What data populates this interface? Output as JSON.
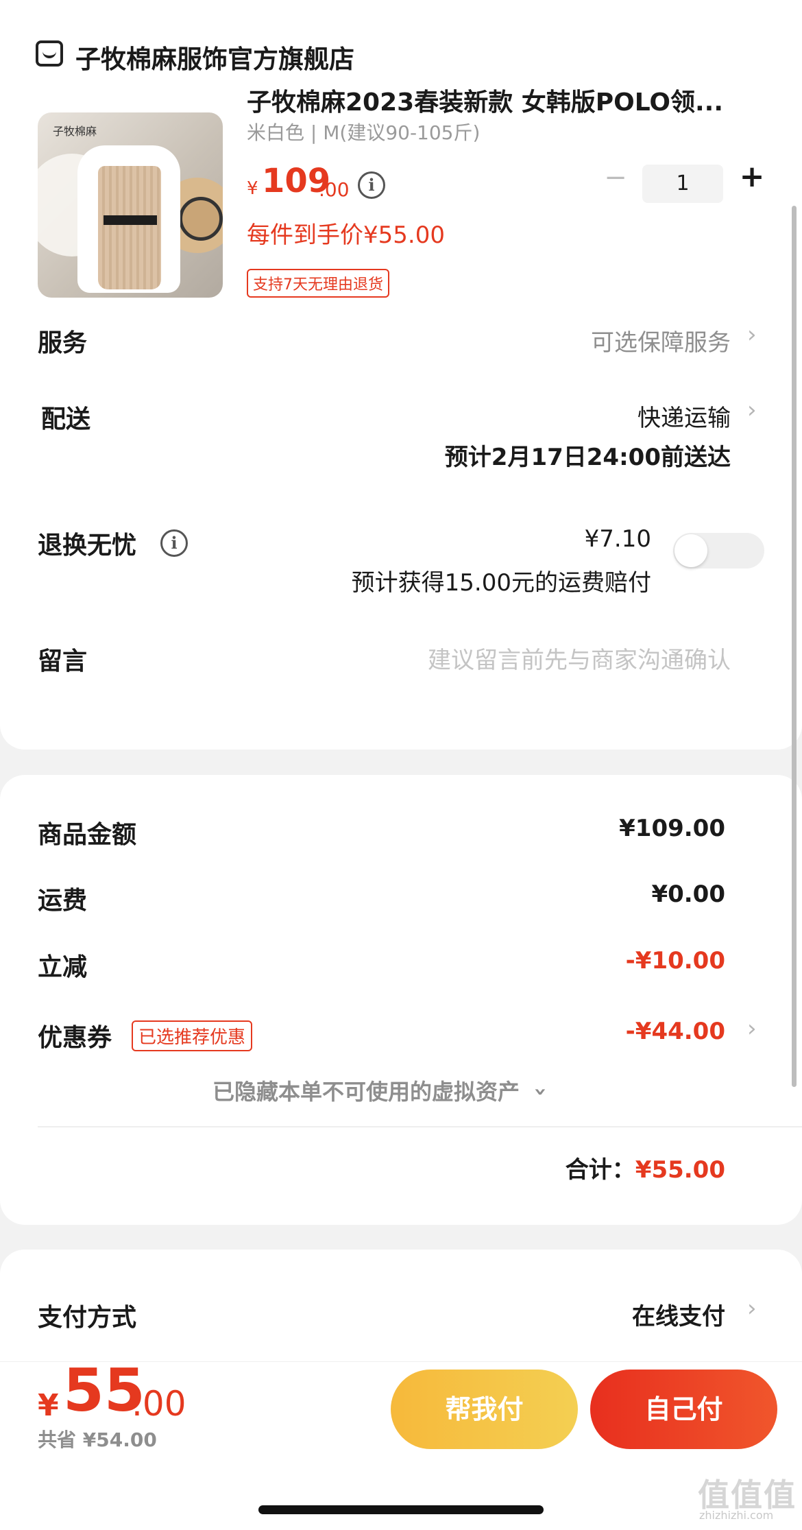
{
  "store": {
    "icon": "store-icon",
    "name": "子牧棉麻服饰官方旗舰店"
  },
  "product": {
    "image_brand": "子牧棉麻",
    "title": "子牧棉麻2023春装新款 女韩版POLO领...",
    "spec": "米白色 | M(建议90-105斤)",
    "price_symbol": "¥",
    "price_int": "109",
    "price_dec": ".00",
    "info_icon": "i",
    "unit_price": "每件到手价¥55.00",
    "return_badge": "支持7天无理由退货",
    "qty_minus": "−",
    "qty": "1",
    "qty_plus": "+"
  },
  "rows": {
    "service_label": "服务",
    "service_value": "可选保障服务",
    "delivery_label": "配送",
    "delivery_value": "快递运输",
    "delivery_eta": "预计2月17日24:00前送达",
    "return_label": "退换无忧",
    "return_price": "¥7.10",
    "return_desc": "预计获得15.00元的运费赔付",
    "return_toggle_on": false,
    "message_label": "留言",
    "message_placeholder": "建议留言前先与商家沟通确认"
  },
  "summary": {
    "goods_label": "商品金额",
    "goods_value": "¥109.00",
    "shipping_label": "运费",
    "shipping_value": "¥0.00",
    "discount_label": "立减",
    "discount_value": "-¥10.00",
    "coupon_label": "优惠券",
    "coupon_tag": "已选推荐优惠",
    "coupon_value": "-¥44.00",
    "hidden_assets": "已隐藏本单不可使用的虚拟资产",
    "total_label": "合计：",
    "total_value": "¥55.00"
  },
  "payment": {
    "label": "支付方式",
    "value": "在线支付"
  },
  "bottom": {
    "symbol": "¥",
    "amount_int": "55",
    "amount_dec": ".00",
    "saved": "共省 ¥54.00",
    "help_pay": "帮我付",
    "self_pay": "自己付"
  },
  "chevron": "›",
  "watermark": "值值值",
  "watermark_sub": "zhizhizhi.com",
  "colors": {
    "accent_red": "#e5391f",
    "help_button": "#f6b93b",
    "self_button": "#e82f1e"
  }
}
